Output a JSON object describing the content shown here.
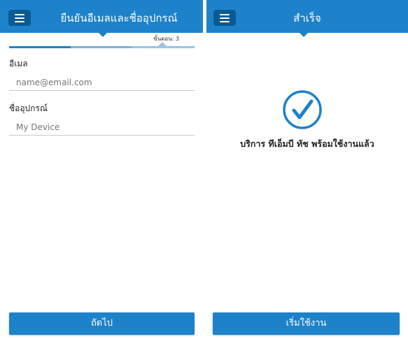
{
  "left_screen": {
    "header": {
      "title": "ยืนยันอีเมลและชื่ออุปกรณ์"
    },
    "step_indicator": "ขั้นตอน: 3",
    "progress": {
      "current_step": 3,
      "total_steps": 3
    },
    "email": {
      "label": "อีเมล",
      "placeholder": "name@email.com"
    },
    "device": {
      "label": "ชื่ออุปกรณ์",
      "placeholder": "My Device"
    },
    "next_button": {
      "label": "ถัดไป"
    }
  },
  "right_screen": {
    "header": {
      "title": "สำเร็จ"
    },
    "success_message": "บริการ ทีเอ็มบี ทัช พร้อมใช้งานแล้ว",
    "start_button": {
      "label": "เริ่มใช้งาน"
    }
  },
  "colors": {
    "primary": "#1d82c9",
    "menu_button": "#0b5a93",
    "progress_mid": "#7fb2dd",
    "progress_light": "#9cc4e6",
    "check": "#1d82c9"
  },
  "icons": {
    "menu": "hamburger-menu-icon",
    "success": "checkmark-circle-icon"
  }
}
